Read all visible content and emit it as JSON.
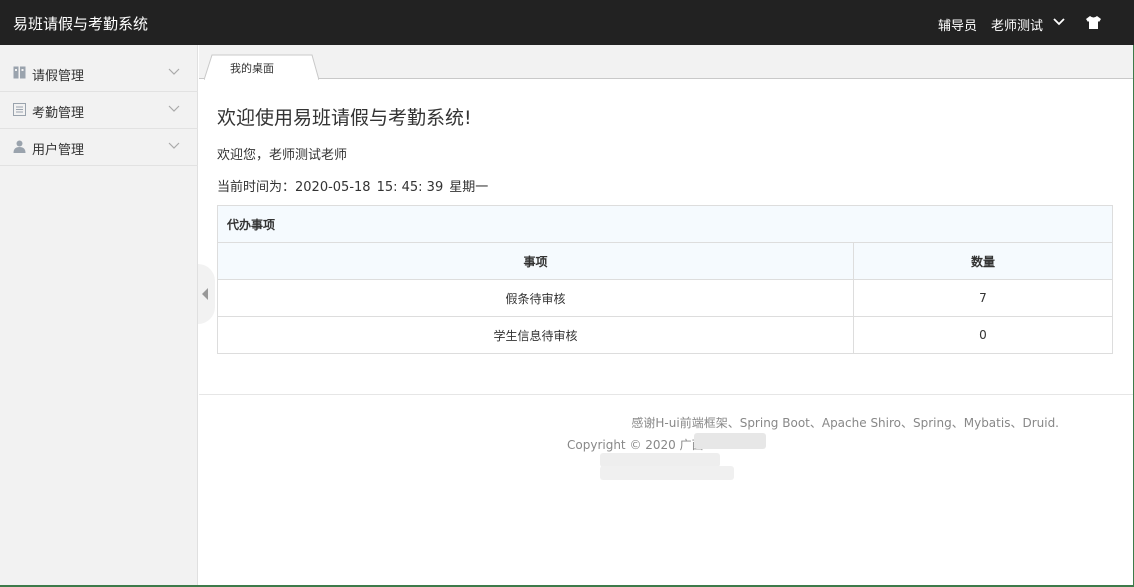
{
  "header": {
    "app_title": "易班请假与考勤系统",
    "role": "辅导员",
    "user_name": "老师测试"
  },
  "sidebar": {
    "items": [
      {
        "label": "请假管理",
        "icon": "grid-icon"
      },
      {
        "label": "考勤管理",
        "icon": "document-icon"
      },
      {
        "label": "用户管理",
        "icon": "user-icon"
      }
    ]
  },
  "tabs": [
    {
      "label": "我的桌面"
    }
  ],
  "main": {
    "welcome_title": "欢迎使用易班请假与考勤系统!",
    "welcome_text": "欢迎您，老师测试老师",
    "time_prefix": "当前时间为：",
    "date": "2020-05-18",
    "time": "15: 45: 39",
    "weekday": "星期一"
  },
  "todo": {
    "caption": "代办事项",
    "columns": [
      "事项",
      "数量"
    ],
    "rows": [
      {
        "item": "假条待审核",
        "count": "7"
      },
      {
        "item": "学生信息待审核",
        "count": "0"
      }
    ]
  },
  "footer": {
    "credits": "感谢H-ui前端框架、Spring Boot、Apache Shiro、Spring、Mybatis、Druid.",
    "copyright": "Copyright © 2020 广西"
  }
}
